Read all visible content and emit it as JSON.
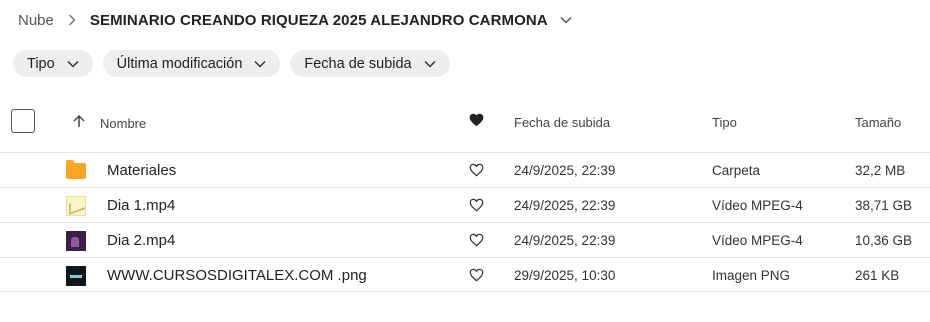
{
  "breadcrumb": {
    "root": "Nube",
    "title": "SEMINARIO CREANDO RIQUEZA 2025 ALEJANDRO CARMONA"
  },
  "filters": [
    {
      "label": "Tipo"
    },
    {
      "label": "Última modificación"
    },
    {
      "label": "Fecha de subida"
    }
  ],
  "columns": {
    "name": "Nombre",
    "date": "Fecha de subida",
    "type": "Tipo",
    "size": "Tamaño"
  },
  "files": [
    {
      "name": "Materiales",
      "icon": "folder-icon",
      "date": "24/9/2025, 22:39",
      "type": "Carpeta",
      "size": "32,2 MB"
    },
    {
      "name": "Dia 1.mp4",
      "icon": "video-thumbnail-icon",
      "date": "24/9/2025, 22:39",
      "type": "Vídeo MPEG-4",
      "size": "38,71 GB"
    },
    {
      "name": "Dia 2.mp4",
      "icon": "video-thumbnail-icon",
      "date": "24/9/2025, 22:39",
      "type": "Vídeo MPEG-4",
      "size": "10,36 GB"
    },
    {
      "name": "WWW.CURSOSDIGITALEX.COM .png",
      "icon": "image-thumbnail-icon",
      "date": "29/9/2025, 10:30",
      "type": "Imagen PNG",
      "size": "261 KB"
    }
  ],
  "colors": {
    "folder": "#f5a623",
    "chip_bg": "#eeeeee",
    "divider": "#e6e6e6"
  }
}
